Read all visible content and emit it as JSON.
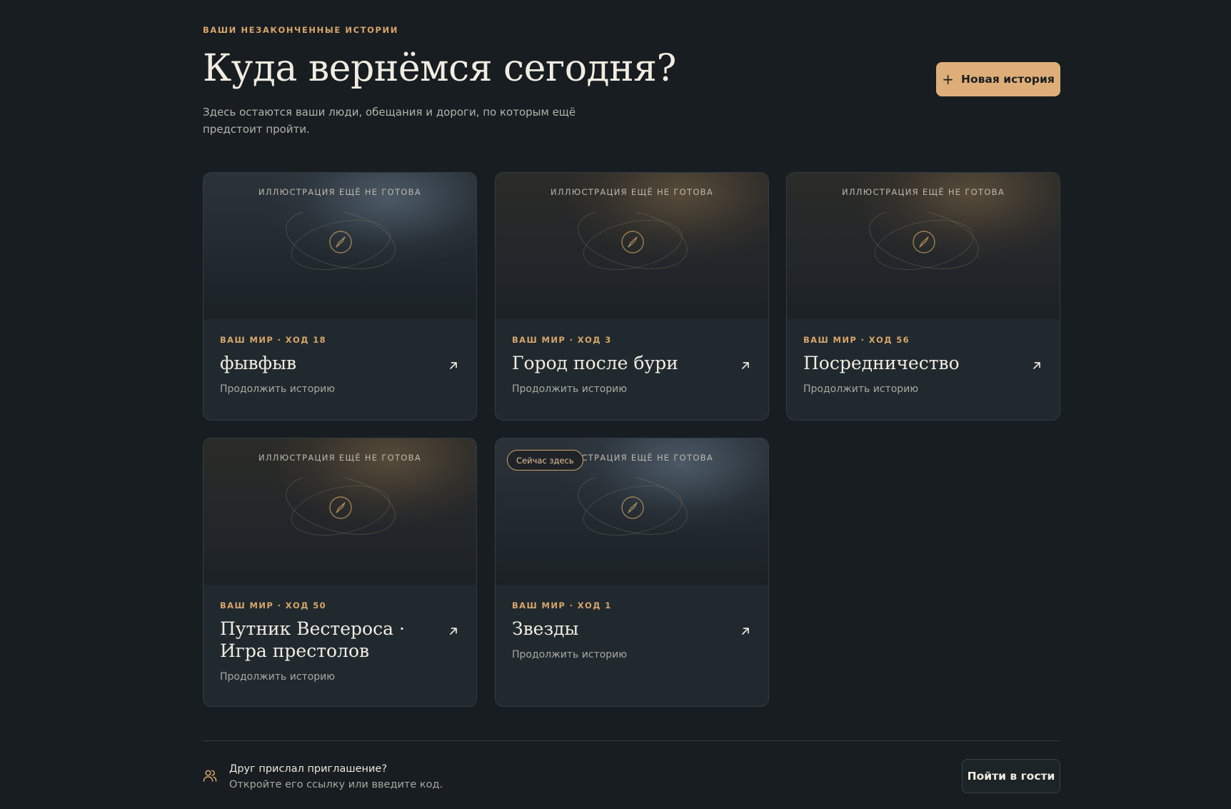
{
  "header": {
    "eyebrow": "ВАШИ НЕЗАКОНЧЕННЫЕ ИСТОРИИ",
    "title": "Куда вернёмся сегодня?",
    "subtitle": "Здесь остаются ваши люди, обещания и дороги, по которым ещё предстоит пройти.",
    "new_story_label": "Новая история",
    "new_story_icon": "plus-icon"
  },
  "stories": [
    {
      "art_caption": "ИЛЛЮСТРАЦИЯ ЕЩЁ НЕ ГОТОВА",
      "art_tone": "blue",
      "meta": "ВАШ МИР · ХОД 18",
      "title": "фывфыв",
      "action": "Продолжить историю"
    },
    {
      "art_caption": "ИЛЛЮСТРАЦИЯ ЕЩЁ НЕ ГОТОВА",
      "art_tone": "gold",
      "meta": "ВАШ МИР · ХОД 3",
      "title": "Город после бури",
      "action": "Продолжить историю"
    },
    {
      "art_caption": "ИЛЛЮСТРАЦИЯ ЕЩЁ НЕ ГОТОВА",
      "art_tone": "gold",
      "meta": "ВАШ МИР · ХОД 56",
      "title": "Посредничество",
      "action": "Продолжить историю"
    },
    {
      "art_caption": "ИЛЛЮСТРАЦИЯ ЕЩЁ НЕ ГОТОВА",
      "art_tone": "gold",
      "meta": "ВАШ МИР · ХОД 50",
      "title": "Путник Вестероса · Игра престолов",
      "action": "Продолжить историю"
    },
    {
      "art_caption": "ИЛЛЮСТРАЦИЯ ЕЩЁ НЕ ГОТОВА",
      "art_tone": "blue",
      "badge": "Сейчас здесь",
      "meta": "ВАШ МИР · ХОД 1",
      "title": "Звезды",
      "action": "Продолжить историю"
    }
  ],
  "invite": {
    "icon": "users-icon",
    "title": "Друг прислал приглашение?",
    "subtitle": "Откройте его ссылку или введите код.",
    "button_label": "Пойти в гости"
  },
  "colors": {
    "background": "#171d21",
    "accent": "#deae79",
    "card": "#20292e"
  }
}
